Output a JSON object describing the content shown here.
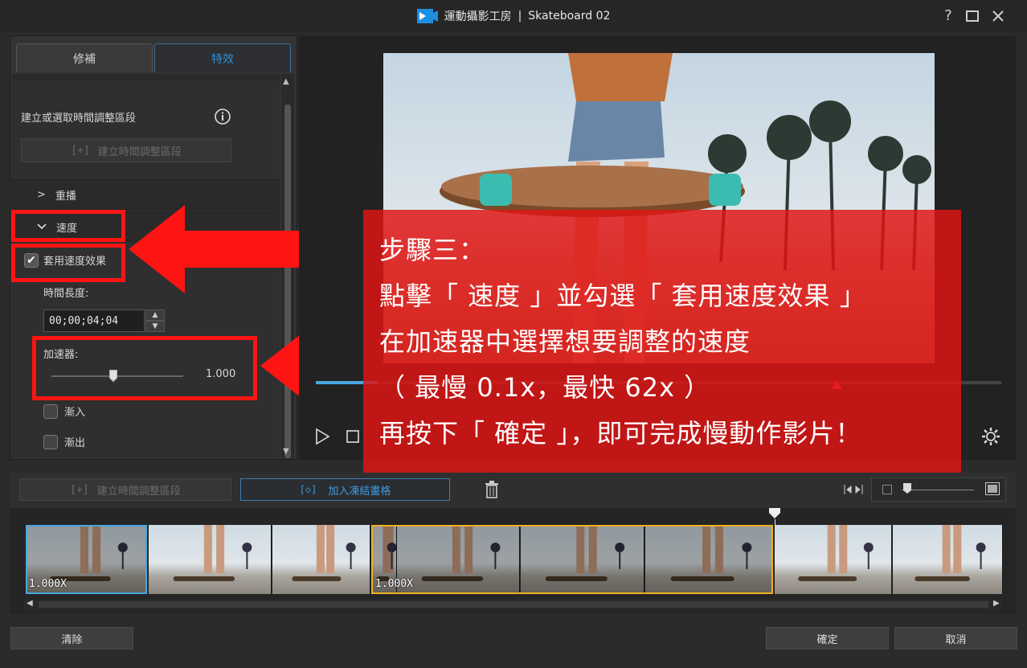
{
  "window": {
    "app_name": "運動攝影工房",
    "separator": "|",
    "project": "Skateboard 02",
    "help": "?",
    "maximize": "☐",
    "close": "✕"
  },
  "tabs": [
    {
      "label": "修補",
      "active": false
    },
    {
      "label": "特效",
      "active": true
    }
  ],
  "panel": {
    "time_segment_text": "建立或選取時間調整區段",
    "create_segment_label": "建立時間調整區段",
    "replay_label": "重播",
    "speed_label": "速度",
    "apply_speed_label": "套用速度效果",
    "apply_speed_checked": true,
    "duration_label": "時間長度:",
    "duration_value": "00;00;04;04",
    "accelerator_label": "加速器:",
    "accelerator_value": "1.000",
    "accelerator_fraction": 0.47,
    "fade_in_label": "漸入",
    "fade_out_label": "漸出"
  },
  "player": {
    "progress_fraction": 0.09,
    "marker_fraction": 0.76
  },
  "overlay": {
    "lines": [
      "步驟三：",
      "點擊「 速度 」並勾選「 套用速度效果 」",
      "在加速器中選擇想要調整的速度",
      "（ 最慢 0.1x，最快 62x ）",
      "再按下「 確定 」，即可完成慢動作影片！"
    ]
  },
  "lower_toolbar": {
    "create_segment_label": "建立時間調整區段",
    "add_freeze_label": "加入凍結畫格"
  },
  "timeline": {
    "segments": [
      {
        "speed": "1.000X"
      },
      {
        "speed": "1.000X"
      }
    ]
  },
  "bottom": {
    "clear_label": "清除",
    "ok_label": "確定",
    "cancel_label": "取消"
  },
  "colors": {
    "accent": "#3f9ae0",
    "overlay_red": "#e01414",
    "annotation_red": "#ff1414",
    "selected_clip": "#f0b020"
  }
}
